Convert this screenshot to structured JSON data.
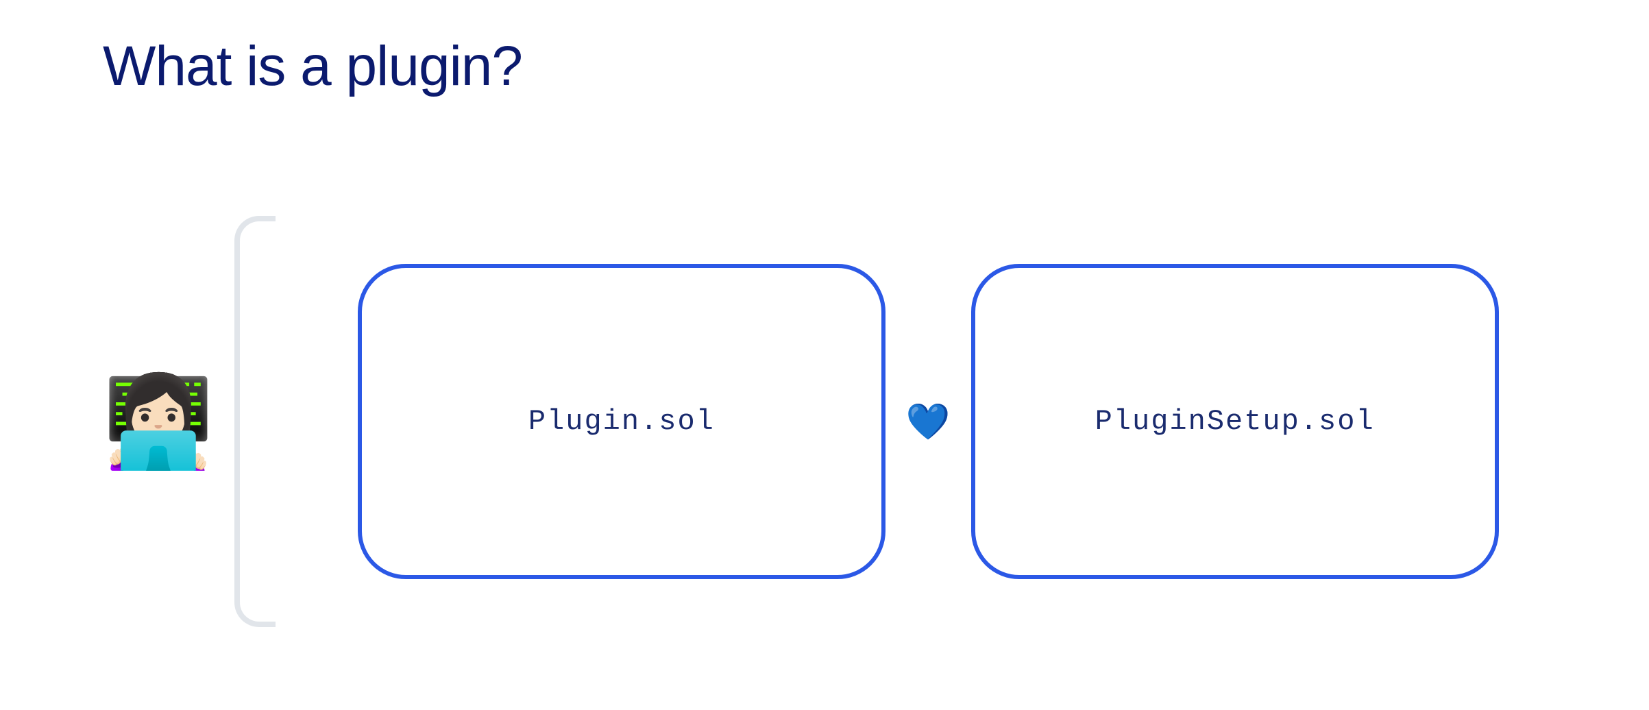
{
  "title": "What is a plugin?",
  "developer_emoji": "👩🏻‍💻",
  "boxes": {
    "left_label": "Plugin.sol",
    "right_label": "PluginSetup.sol"
  },
  "heart_emoji": "💙",
  "colors": {
    "title": "#0b1a6e",
    "box_border": "#2b58e6",
    "code_text": "#1a2b6e",
    "bracket": "#e1e5ea"
  }
}
